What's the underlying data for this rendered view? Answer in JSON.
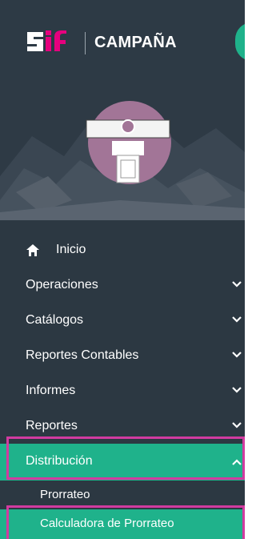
{
  "header": {
    "logo_text": "SIF",
    "title": "CAMPAÑA"
  },
  "icons": {
    "home": "home-icon",
    "chevron": "chevron-down-icon",
    "chevron_up": "chevron-up-icon",
    "avatar": "podium-speaker-icon"
  },
  "colors": {
    "sidebar_bg": "#2c3842",
    "accent": "#1fb28b",
    "highlight": "#d13ba0",
    "avatar_bg": "#a27597"
  },
  "menu": {
    "inicio": "Inicio",
    "operaciones": "Operaciones",
    "catalogos": "Catálogos",
    "reportes_contables": "Reportes Contables",
    "informes": "Informes",
    "reportes": "Reportes",
    "distribucion": "Distribución",
    "sub_prorrateo": "Prorrateo",
    "sub_calculadora": "Calculadora de Prorrateo"
  }
}
